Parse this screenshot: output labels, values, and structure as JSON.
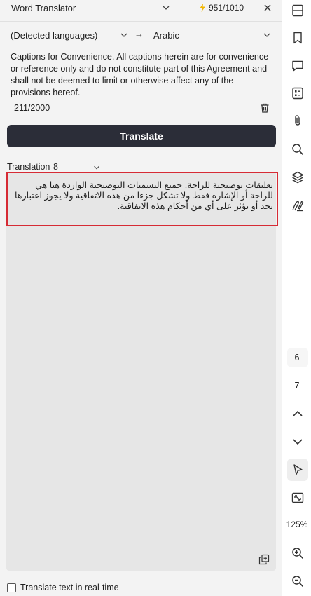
{
  "toolbar": {
    "tool_name": "Word Translator",
    "credits": "951/1010",
    "credits_icon": "lightning-icon",
    "close_icon": "close-icon"
  },
  "languages": {
    "source": "(Detected languages)",
    "arrow": "→",
    "target": "Arabic"
  },
  "source": {
    "text": "Captions for Convenience. All captions herein are for convenience or reference only and do not constitute part of this Agreement and shall not be deemed to limit or otherwise affect any of the provisions hereof.",
    "char_count": "211/2000"
  },
  "actions": {
    "translate_label": "Translate"
  },
  "translation": {
    "label": "Translation",
    "count": "8",
    "text": "تعليقات توضيحية للراحة. جميع التسميات التوضيحية الواردة هنا هي للراحة أو الإشارة فقط ولا تشكل جزءا من هذه الاتفاقية ولا يجوز اعتبارها تحد أو تؤثر على أي من أحكام هذه الاتفاقية."
  },
  "footer": {
    "realtime_label": "Translate text in real-time",
    "realtime_checked": false
  },
  "rail": {
    "page_current": "6",
    "page_next": "7",
    "zoom": "125%"
  },
  "colors": {
    "accent_button": "#2b2d38",
    "highlight_border": "#d62b35",
    "panel_bg": "#f3f3f3",
    "output_bg": "#e6e6e6"
  }
}
